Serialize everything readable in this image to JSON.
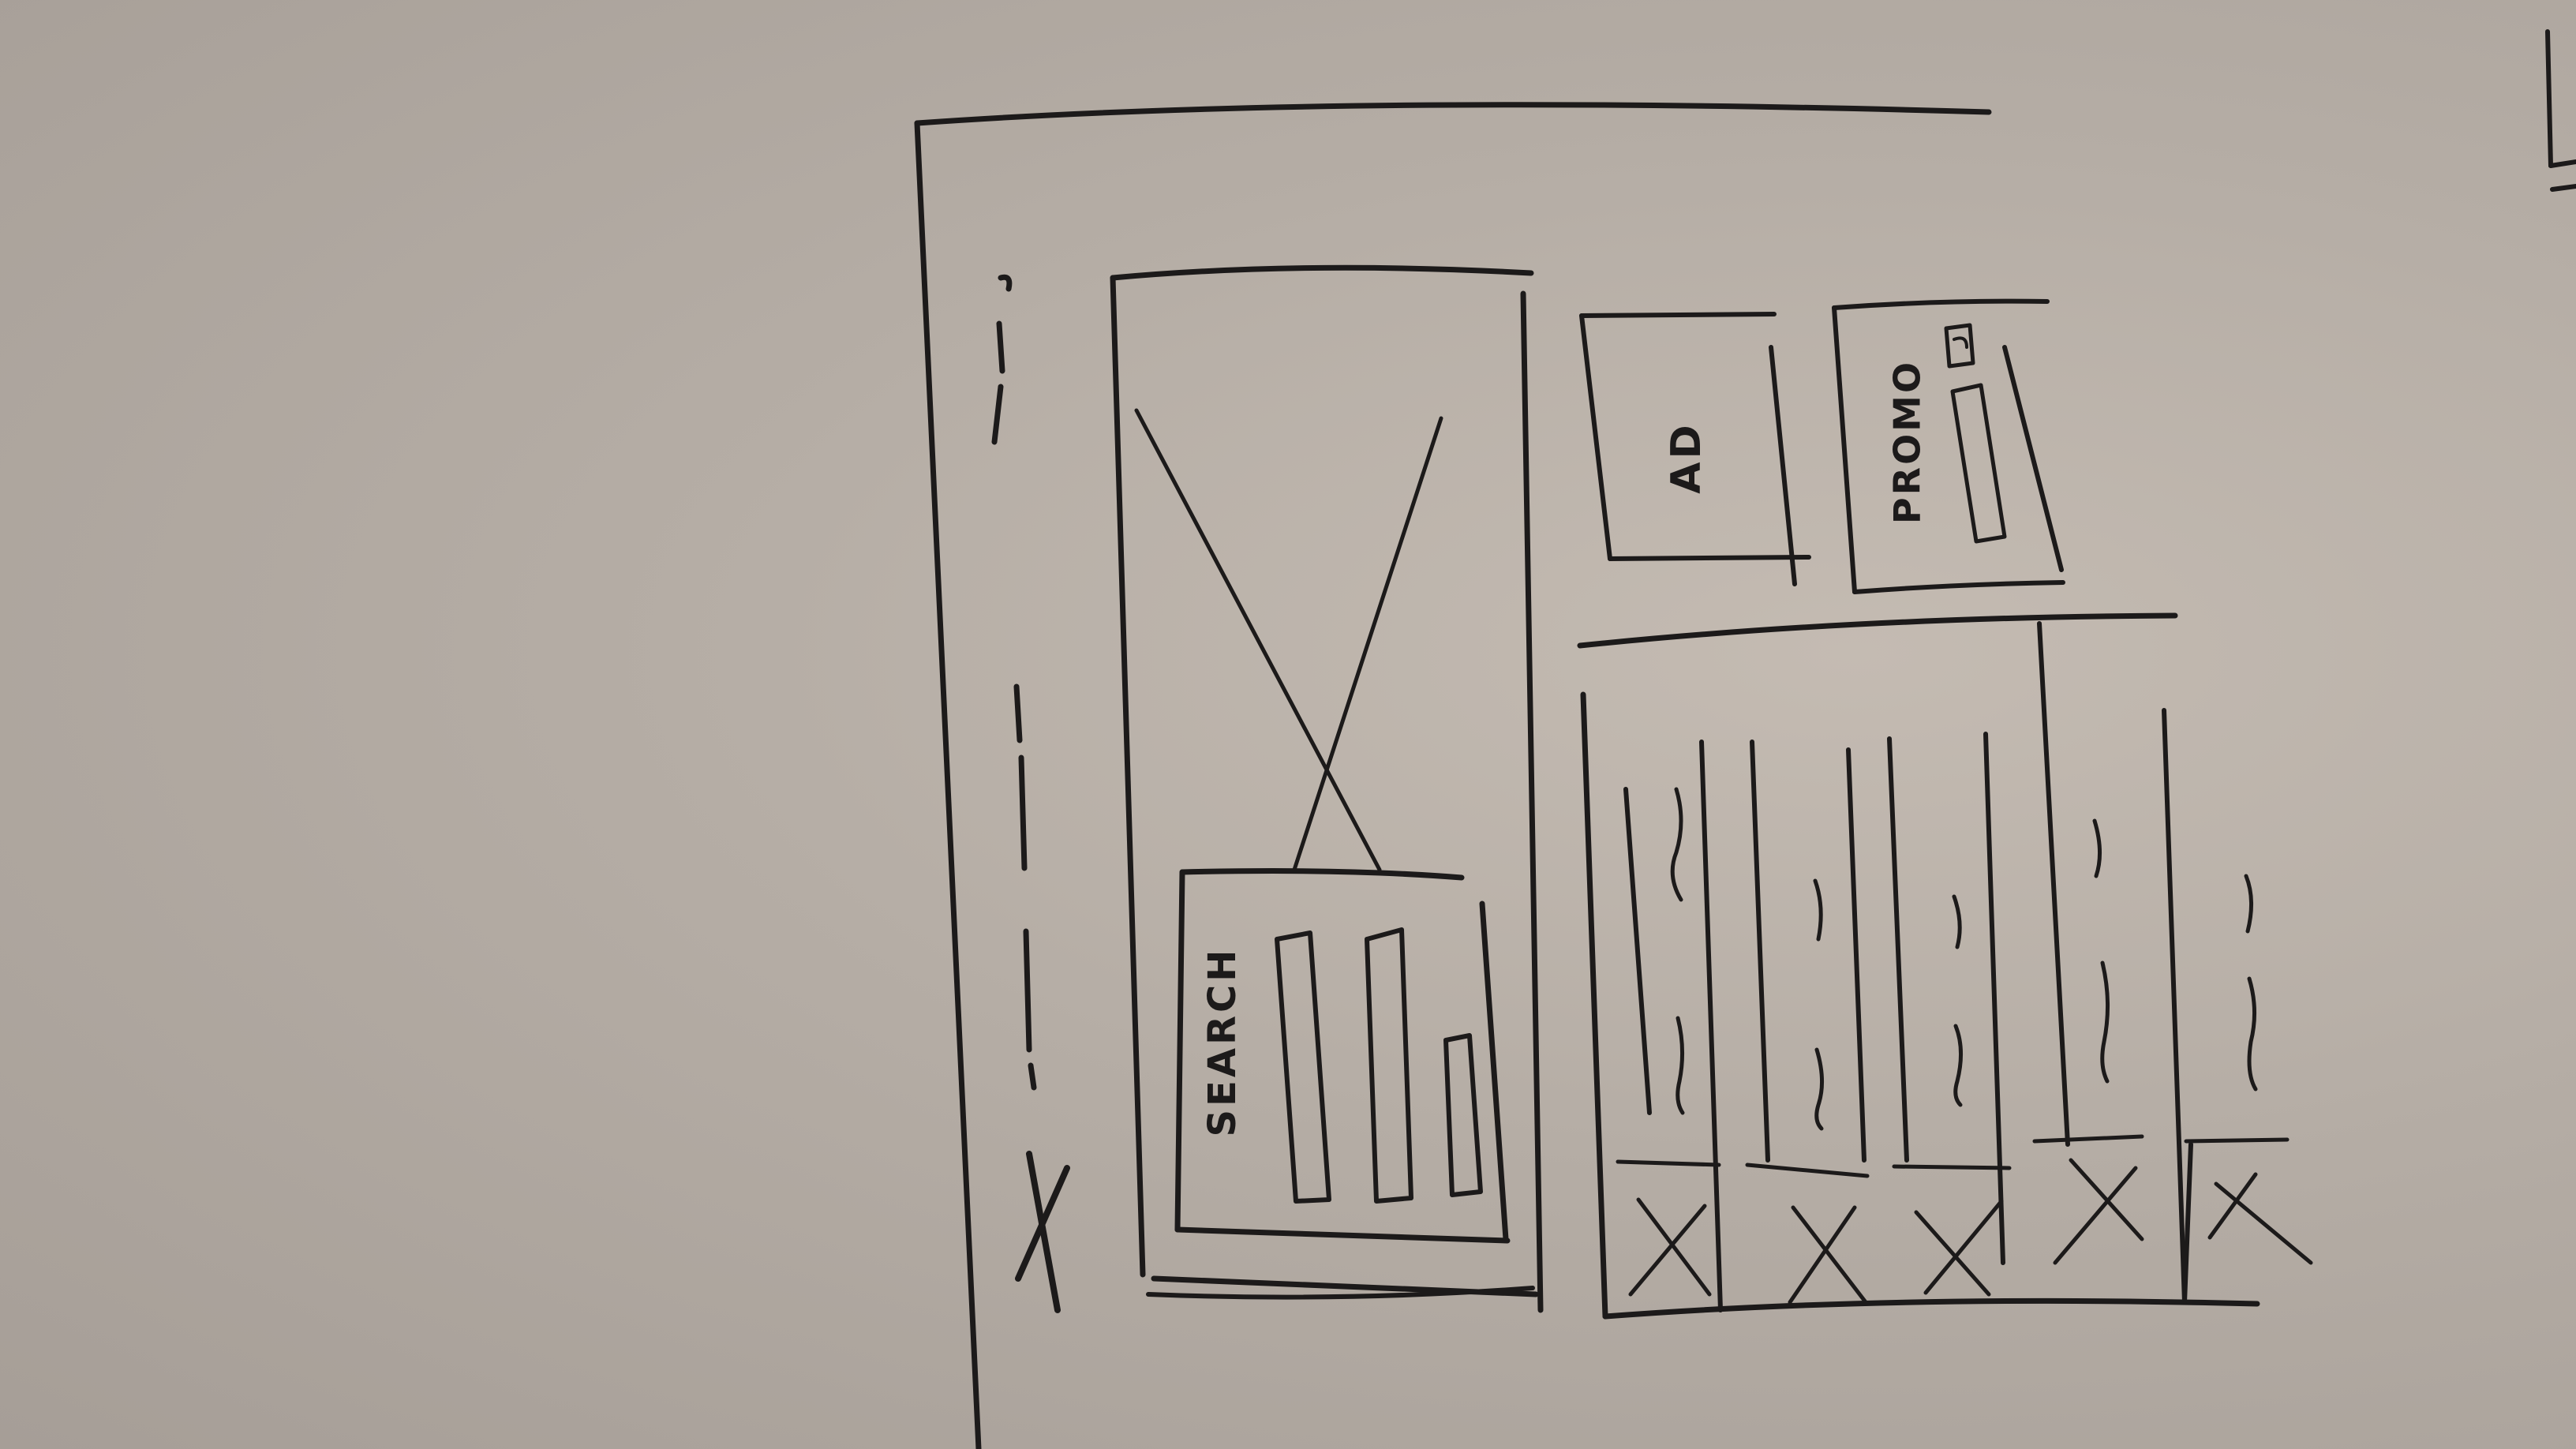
{
  "sketch": {
    "search_label": "SEARCH",
    "ad_label": "AD",
    "promo_label": "PROMO"
  },
  "colors": {
    "paper": "#b5ada5",
    "ink": "#1c1a1a"
  }
}
